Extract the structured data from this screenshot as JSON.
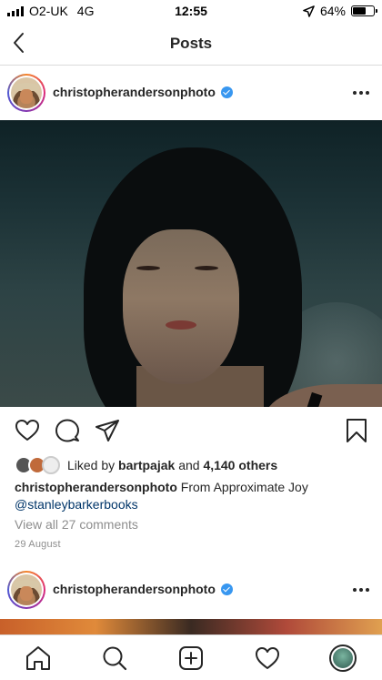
{
  "status_bar": {
    "carrier": "O2-UK",
    "network": "4G",
    "time": "12:55",
    "battery": "64%",
    "battery_level": 0.64,
    "icons": [
      "signal-bars-icon",
      "location-arrow-icon",
      "battery-icon"
    ]
  },
  "header": {
    "title": "Posts",
    "back_icon": "chevron-left-icon"
  },
  "post": {
    "username": "christopherandersonphoto",
    "verified": true,
    "more_icon": "ellipsis-icon",
    "action_icons": [
      "heart-icon",
      "comment-icon",
      "share-icon",
      "bookmark-icon"
    ],
    "likes": {
      "prefix": "Liked by",
      "liked_by": "bartpajak",
      "and": "and",
      "others": "4,140 others"
    },
    "caption_user": "christopherandersonphoto",
    "caption_text": "From Approximate Joy",
    "caption_mention": "@stanleybarkerbooks",
    "view_comments": "View all 27 comments",
    "date": "29 August"
  },
  "next_post": {
    "username": "christopherandersonphoto",
    "verified": true
  },
  "tab_bar": {
    "icons": [
      "home-icon",
      "search-icon",
      "new-post-icon",
      "activity-heart-icon",
      "profile-avatar"
    ]
  },
  "colors": {
    "link": "#003569",
    "verified": "#3897f0",
    "muted": "#8e8e8e",
    "divider": "#dbdbdb"
  }
}
